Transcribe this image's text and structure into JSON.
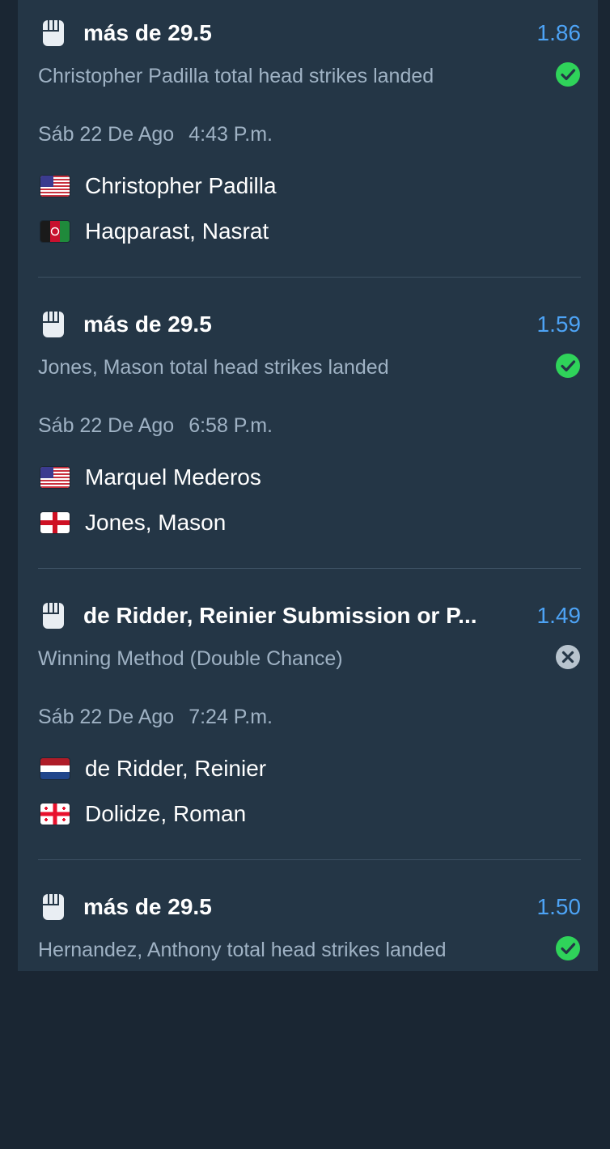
{
  "bets": [
    {
      "market": "más de 29.5",
      "odds": "1.86",
      "description": "Christopher Padilla total head strikes landed",
      "status": "won",
      "date": "Sáb 22 De Ago",
      "time": "4:43 P.m.",
      "fighters": [
        {
          "name": "Christopher Padilla",
          "flag": "us-flag"
        },
        {
          "name": "Haqparast, Nasrat",
          "flag": "af-flag"
        }
      ]
    },
    {
      "market": "más de 29.5",
      "odds": "1.59",
      "description": "Jones, Mason total head strikes landed",
      "status": "won",
      "date": "Sáb 22 De Ago",
      "time": "6:58 P.m.",
      "fighters": [
        {
          "name": "Marquel Mederos",
          "flag": "us-flag"
        },
        {
          "name": "Jones, Mason",
          "flag": "england-flag"
        }
      ]
    },
    {
      "market": "de Ridder, Reinier Submission or P...",
      "odds": "1.49",
      "description": "Winning Method (Double Chance)",
      "status": "lost",
      "date": "Sáb 22 De Ago",
      "time": "7:24 P.m.",
      "fighters": [
        {
          "name": "de Ridder, Reinier",
          "flag": "nl-flag"
        },
        {
          "name": "Dolidze, Roman",
          "flag": "ge-flag"
        }
      ]
    },
    {
      "market": "más de 29.5",
      "odds": "1.50",
      "description": "Hernandez, Anthony total head strikes landed",
      "status": "won"
    }
  ],
  "colors": {
    "background": "#1a2633",
    "panel": "#243646",
    "odds": "#4da3f5",
    "won": "#2fd35a",
    "lost": "#b8c4ce",
    "muted_text": "#9fb2c4"
  },
  "icons": {
    "market": "fist-icon",
    "won": "check-circle-icon",
    "lost": "x-circle-icon"
  }
}
